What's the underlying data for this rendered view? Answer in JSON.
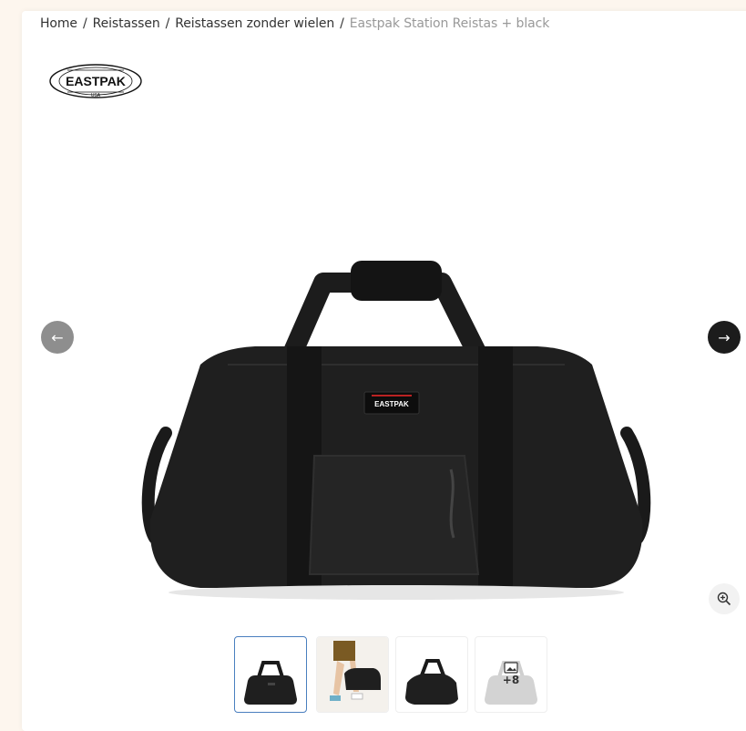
{
  "breadcrumb": {
    "items": [
      "Home",
      "Reistassen",
      "Reistassen zonder wielen"
    ],
    "separator": "/",
    "current": "Eastpak Station Reistas + black"
  },
  "brand": {
    "name": "EASTPAK",
    "sub": "USA"
  },
  "product": {
    "bag_label": "EASTPAK"
  },
  "gallery": {
    "prev_icon": "←",
    "next_icon": "→",
    "zoom_icon": "zoom-in-icon",
    "more_count": "+8",
    "thumbnails": [
      "bag-front",
      "model-carrying-bag",
      "bag-side",
      "more-images"
    ]
  },
  "colors": {
    "accent_border": "#4a7fbf",
    "page_bg": "#fdf6ee"
  }
}
